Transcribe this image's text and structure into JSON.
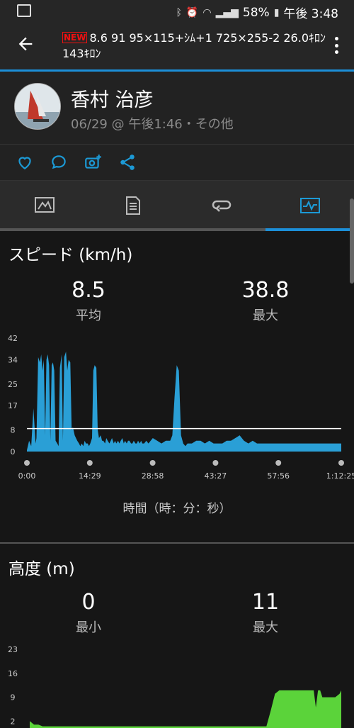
{
  "status_bar": {
    "battery": "58%",
    "time": "午後 3:48"
  },
  "header": {
    "badge": "NEW",
    "title": "8.6 91 95×115+ｼﾑ+1 725×255-2 26.0ｷﾛﾝ143ｷﾛﾝ"
  },
  "profile": {
    "name": "香村 治彦",
    "meta": "06/29 @ 午後1:46・その他"
  },
  "speed": {
    "title": "スピード (km/h)",
    "avg_value": "8.5",
    "avg_label": "平均",
    "max_value": "38.8",
    "max_label": "最大",
    "xlabel": "時間（時：分：秒）"
  },
  "elevation": {
    "title": "高度 (m)",
    "min_value": "0",
    "min_label": "最小",
    "max_value": "11",
    "max_label": "最大"
  },
  "chart_data": [
    {
      "type": "area",
      "title": "スピード (km/h)",
      "xlabel": "時間（時：分：秒）",
      "x_ticks": [
        "0:00",
        "14:29",
        "28:58",
        "43:27",
        "57:56",
        "1:12:25"
      ],
      "y_ticks": [
        0,
        8,
        17,
        25,
        34,
        42
      ],
      "ylim": [
        0,
        42
      ],
      "average": 8.5,
      "color": "#2a9fd6",
      "series": [
        {
          "x": [
            0,
            0.5,
            1,
            1.5,
            2,
            2.2,
            2.6,
            3,
            3.3,
            3.6,
            3.9,
            4.2,
            4.5,
            4.8,
            5.1,
            5.4,
            5.7,
            6.0,
            6.3,
            6.6,
            7,
            7.3,
            7.6,
            8.0,
            8.3,
            8.6,
            9,
            9.3,
            9.6,
            10,
            10.3,
            10.6,
            11,
            11.3,
            11.6,
            12,
            12.3,
            12.6,
            13,
            13.3,
            13.6,
            14,
            14.3,
            14.6,
            15,
            15.3,
            15.6,
            16,
            16.3,
            16.6,
            17,
            17.3,
            17.6,
            18,
            18.3,
            18.6,
            19,
            19.3,
            19.6,
            20,
            20.3,
            20.6,
            21,
            21.3,
            21.6,
            22,
            22.3,
            22.6,
            23,
            23.3,
            23.6,
            24,
            24.3,
            24.6,
            25,
            25.3,
            25.6,
            26,
            26.3,
            26.6,
            27,
            27.5,
            28,
            29,
            30,
            31,
            32,
            33,
            33.5,
            34,
            34.5,
            35,
            35.5,
            36,
            36.5,
            37,
            38,
            39,
            40,
            41,
            42,
            43,
            44,
            45,
            46,
            47,
            48,
            49,
            50,
            51,
            52,
            53,
            54,
            55,
            56,
            57,
            58,
            59,
            60,
            61,
            62,
            63,
            64,
            65,
            66,
            67,
            68,
            69,
            70,
            71,
            72,
            72.4
          ],
          "values": [
            0.5,
            4,
            2,
            16,
            3,
            5,
            35,
            33,
            36,
            30,
            34,
            6,
            34,
            36,
            32,
            4,
            32,
            33,
            30,
            4,
            3,
            2,
            31,
            36,
            4,
            35,
            37,
            30,
            34,
            33,
            8,
            9,
            6,
            5,
            4,
            3,
            2,
            3,
            2,
            4,
            3,
            3,
            2,
            3,
            5,
            30,
            32,
            31,
            8,
            5,
            6,
            4,
            4,
            3,
            5,
            4,
            3,
            4,
            5,
            3,
            4,
            3,
            4,
            3,
            4,
            5,
            3,
            4,
            3,
            4,
            4,
            3,
            3,
            4,
            3,
            3,
            4,
            3,
            4,
            3,
            3,
            4,
            3,
            5,
            4,
            3,
            4,
            4,
            6,
            20,
            32,
            30,
            6,
            3,
            2,
            3,
            3,
            4,
            4,
            3,
            4,
            3,
            3,
            3,
            4,
            4,
            5,
            6,
            4,
            3,
            4,
            3,
            3,
            3,
            3,
            3,
            3,
            3,
            3,
            3,
            3,
            3,
            3,
            3,
            3,
            3,
            3,
            3,
            3,
            3,
            3,
            3
          ]
        }
      ]
    },
    {
      "type": "area",
      "title": "高度 (m)",
      "y_ticks": [
        2,
        9,
        16,
        23
      ],
      "ylim": [
        0,
        23
      ],
      "color": "#5bd33a",
      "series": [
        {
          "x": [
            0,
            1,
            2,
            3,
            4,
            5,
            6,
            7,
            8,
            9,
            10,
            11,
            12,
            13,
            14,
            15,
            16,
            17,
            18,
            19,
            20,
            21,
            22,
            23,
            24,
            25,
            26,
            27,
            28,
            29,
            30,
            31,
            32,
            33,
            34,
            35,
            36,
            37,
            38,
            39,
            40,
            41,
            42,
            43,
            44,
            45,
            46,
            47,
            48,
            49,
            50,
            51,
            52,
            53,
            54,
            55,
            56,
            57,
            58,
            58.5,
            59,
            59.5,
            60,
            61,
            62,
            63,
            64,
            65,
            66,
            66.5,
            67,
            67.5,
            68,
            69,
            70,
            71,
            72,
            72.4
          ],
          "values": [
            2,
            1,
            1,
            0.5,
            0.5,
            0.5,
            0.5,
            0.5,
            0.5,
            0.5,
            0.5,
            0.5,
            0.5,
            0.5,
            0.5,
            0.5,
            0.5,
            0.5,
            0.5,
            0.5,
            0.5,
            0.5,
            0.5,
            0.5,
            0.5,
            0.5,
            0.5,
            0.5,
            0.5,
            0.5,
            0.5,
            0.5,
            0.5,
            0.5,
            0.5,
            0.5,
            0.5,
            0.5,
            0.5,
            0.5,
            0.5,
            0.5,
            0.5,
            0.5,
            0.5,
            0.5,
            0.5,
            0.5,
            0.5,
            0.5,
            0.5,
            0.5,
            0.5,
            0.5,
            0.5,
            0.5,
            5,
            10,
            11,
            11,
            11,
            11,
            11,
            11,
            11,
            11,
            11,
            11,
            11,
            6,
            11,
            11,
            9,
            9,
            9,
            9,
            10,
            11
          ]
        }
      ]
    }
  ]
}
